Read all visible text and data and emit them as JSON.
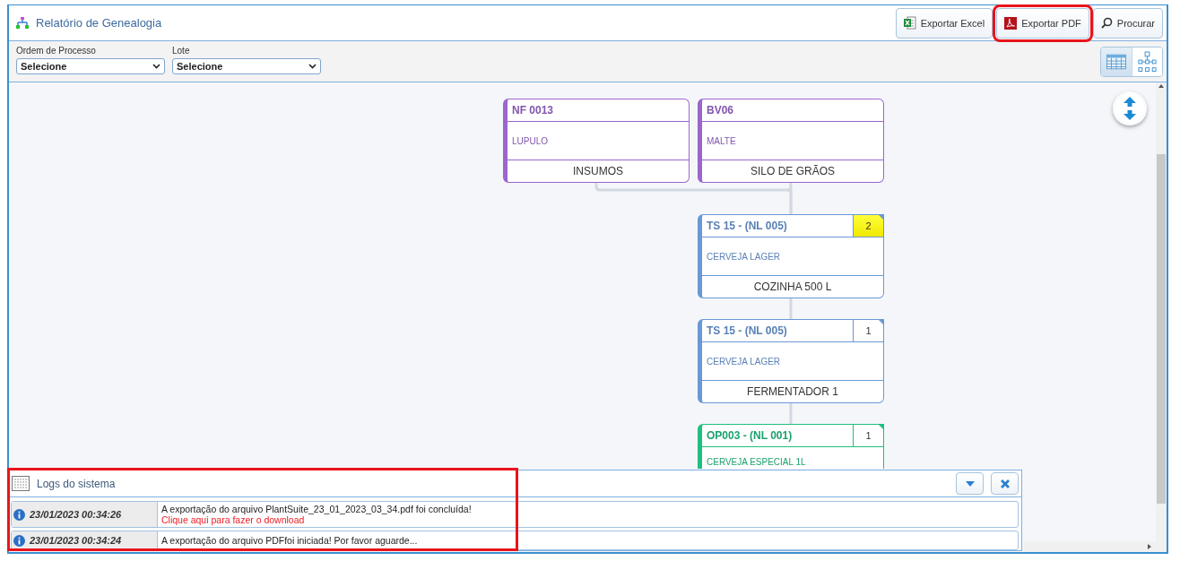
{
  "header": {
    "title": "Relatório de Genealogia",
    "buttons": [
      {
        "kind": "excel",
        "label": "Exportar Excel",
        "highlighted": false
      },
      {
        "kind": "pdf",
        "label": "Exportar PDF",
        "highlighted": true
      },
      {
        "kind": "search",
        "label": "Procurar",
        "highlighted": false
      }
    ]
  },
  "filters": [
    {
      "label": "Ordem de Processo",
      "value": "Selecione"
    },
    {
      "label": "Lote",
      "value": "Selecione"
    }
  ],
  "view_toggle": [
    {
      "kind": "table",
      "selected": true
    },
    {
      "kind": "tree",
      "selected": false
    }
  ],
  "diagram": {
    "levels": [
      [
        {
          "code": "NF 0013",
          "description": "LUPULO",
          "location": "INSUMOS",
          "color": "#9a66cc"
        },
        {
          "code": "BV06",
          "description": "MALTE",
          "location": "SILO DE GRÃOS",
          "color": "#9a66cc"
        }
      ],
      [
        {
          "code": "TS 15 - (NL 005)",
          "description": "CERVEJA LAGER",
          "location": "COZINHA 500 L",
          "badge": "2",
          "badge_highlighted": true,
          "color": "#6a98d6"
        }
      ],
      [
        {
          "code": "TS 15 - (NL 005)",
          "description": "CERVEJA LAGER",
          "location": "FERMENTADOR 1",
          "badge": "1",
          "badge_highlighted": false,
          "color": "#6a98d6"
        }
      ],
      [
        {
          "code": "OP003 - (NL 001)",
          "description": "CERVEJA ESPECIAL 1L",
          "badge": "1",
          "badge_highlighted": false,
          "color": "#1fbf80"
        }
      ]
    ]
  },
  "logs": {
    "title": "Logs do sistema",
    "highlighted": true,
    "entries": [
      {
        "time": "23/01/2023 00:34:26",
        "message": "A exportação do arquivo PlantSuite_23_01_2023_03_34.pdf foi concluída!",
        "link": "Clique aqui para fazer o download"
      },
      {
        "time": "23/01/2023 00:34:24",
        "message": "A exportação do arquivo PDFfoi iniciada! Por favor aguarde..."
      }
    ]
  }
}
